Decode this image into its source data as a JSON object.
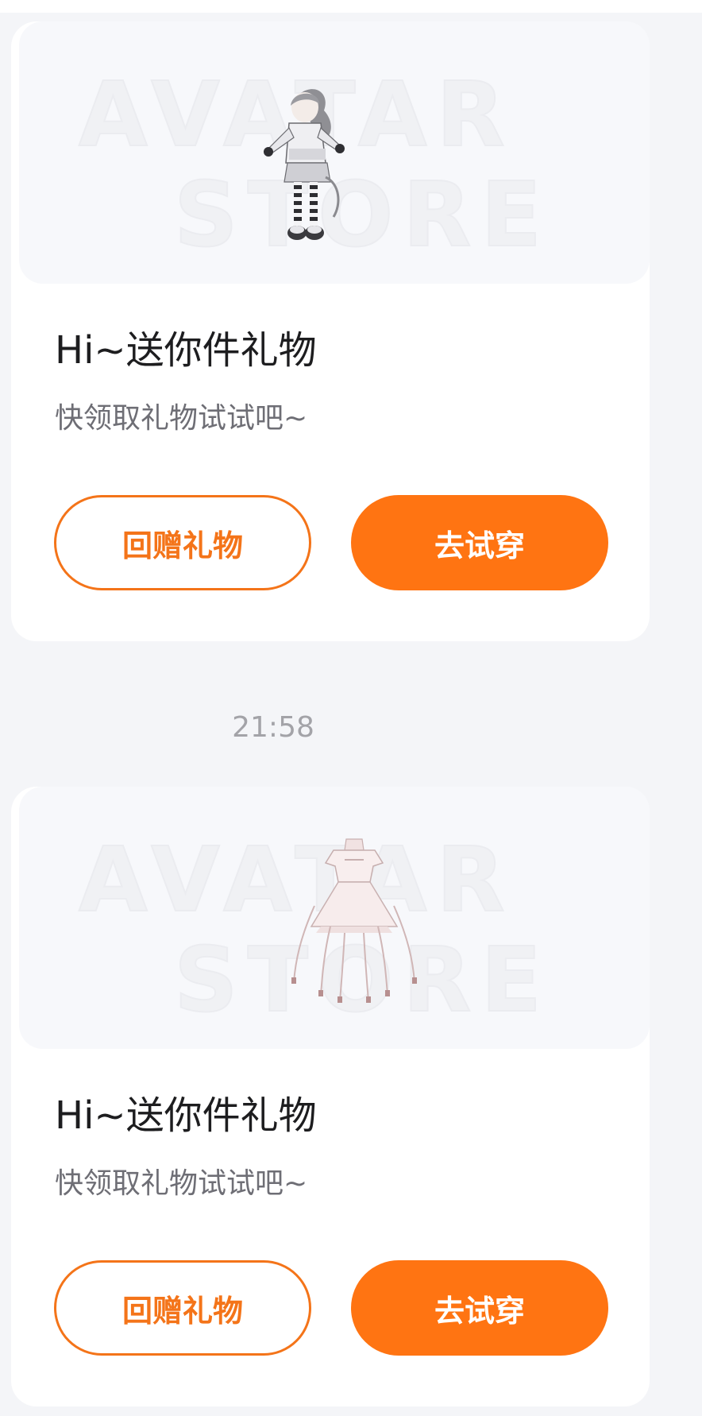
{
  "cards": [
    {
      "watermark_line1": "AVATAR",
      "watermark_line2": "STORE",
      "item_icon": "avatar-girl-outfit",
      "title": "Hi~送你件礼物",
      "subtitle": "快领取礼物试试吧~",
      "return_gift_label": "回赠礼物",
      "try_on_label": "去试穿"
    },
    {
      "watermark_line1": "AVATAR",
      "watermark_line2": "STORE",
      "item_icon": "white-dress",
      "title": "Hi~送你件礼物",
      "subtitle": "快领取礼物试试吧~",
      "return_gift_label": "回赠礼物",
      "try_on_label": "去试穿"
    }
  ],
  "timestamp": "21:58",
  "colors": {
    "accent": "#ff7412",
    "background": "#f4f5f8",
    "card": "#ffffff"
  }
}
